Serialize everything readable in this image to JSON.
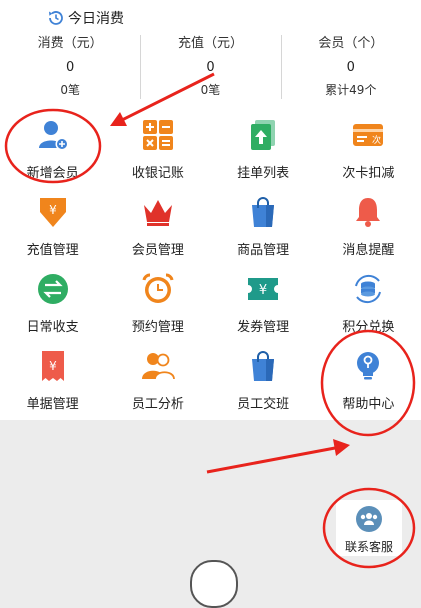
{
  "header": {
    "title": "今日消费"
  },
  "stats": [
    {
      "label": "消费（元）",
      "value": "0",
      "sub": "0笔"
    },
    {
      "label": "充值（元）",
      "value": "0",
      "sub": "0笔"
    },
    {
      "label": "会员（个）",
      "value": "0",
      "sub": "累计49个"
    }
  ],
  "grid": [
    {
      "label": "新增会员",
      "icon": "add-member-icon"
    },
    {
      "label": "收银记账",
      "icon": "calculator-icon"
    },
    {
      "label": "挂单列表",
      "icon": "pending-list-icon"
    },
    {
      "label": "次卡扣减",
      "icon": "card-deduct-icon"
    },
    {
      "label": "充值管理",
      "icon": "recharge-icon"
    },
    {
      "label": "会员管理",
      "icon": "crown-icon"
    },
    {
      "label": "商品管理",
      "icon": "shopping-bag-icon"
    },
    {
      "label": "消息提醒",
      "icon": "bell-icon"
    },
    {
      "label": "日常收支",
      "icon": "exchange-icon"
    },
    {
      "label": "预约管理",
      "icon": "alarm-clock-icon"
    },
    {
      "label": "发券管理",
      "icon": "coupon-icon"
    },
    {
      "label": "积分兑换",
      "icon": "points-exchange-icon"
    },
    {
      "label": "单据管理",
      "icon": "receipt-icon"
    },
    {
      "label": "员工分析",
      "icon": "staff-icon"
    },
    {
      "label": "员工交班",
      "icon": "shift-bag-icon"
    },
    {
      "label": "帮助中心",
      "icon": "lightbulb-icon"
    }
  ],
  "contact": {
    "label": "联系客服",
    "icon": "customer-service-icon"
  },
  "colors": {
    "blue": "#3f82d6",
    "orange": "#f0851c",
    "red": "#e0322a",
    "green": "#2fad63",
    "teal": "#1f9a8a",
    "annotation": "#e8231c"
  }
}
